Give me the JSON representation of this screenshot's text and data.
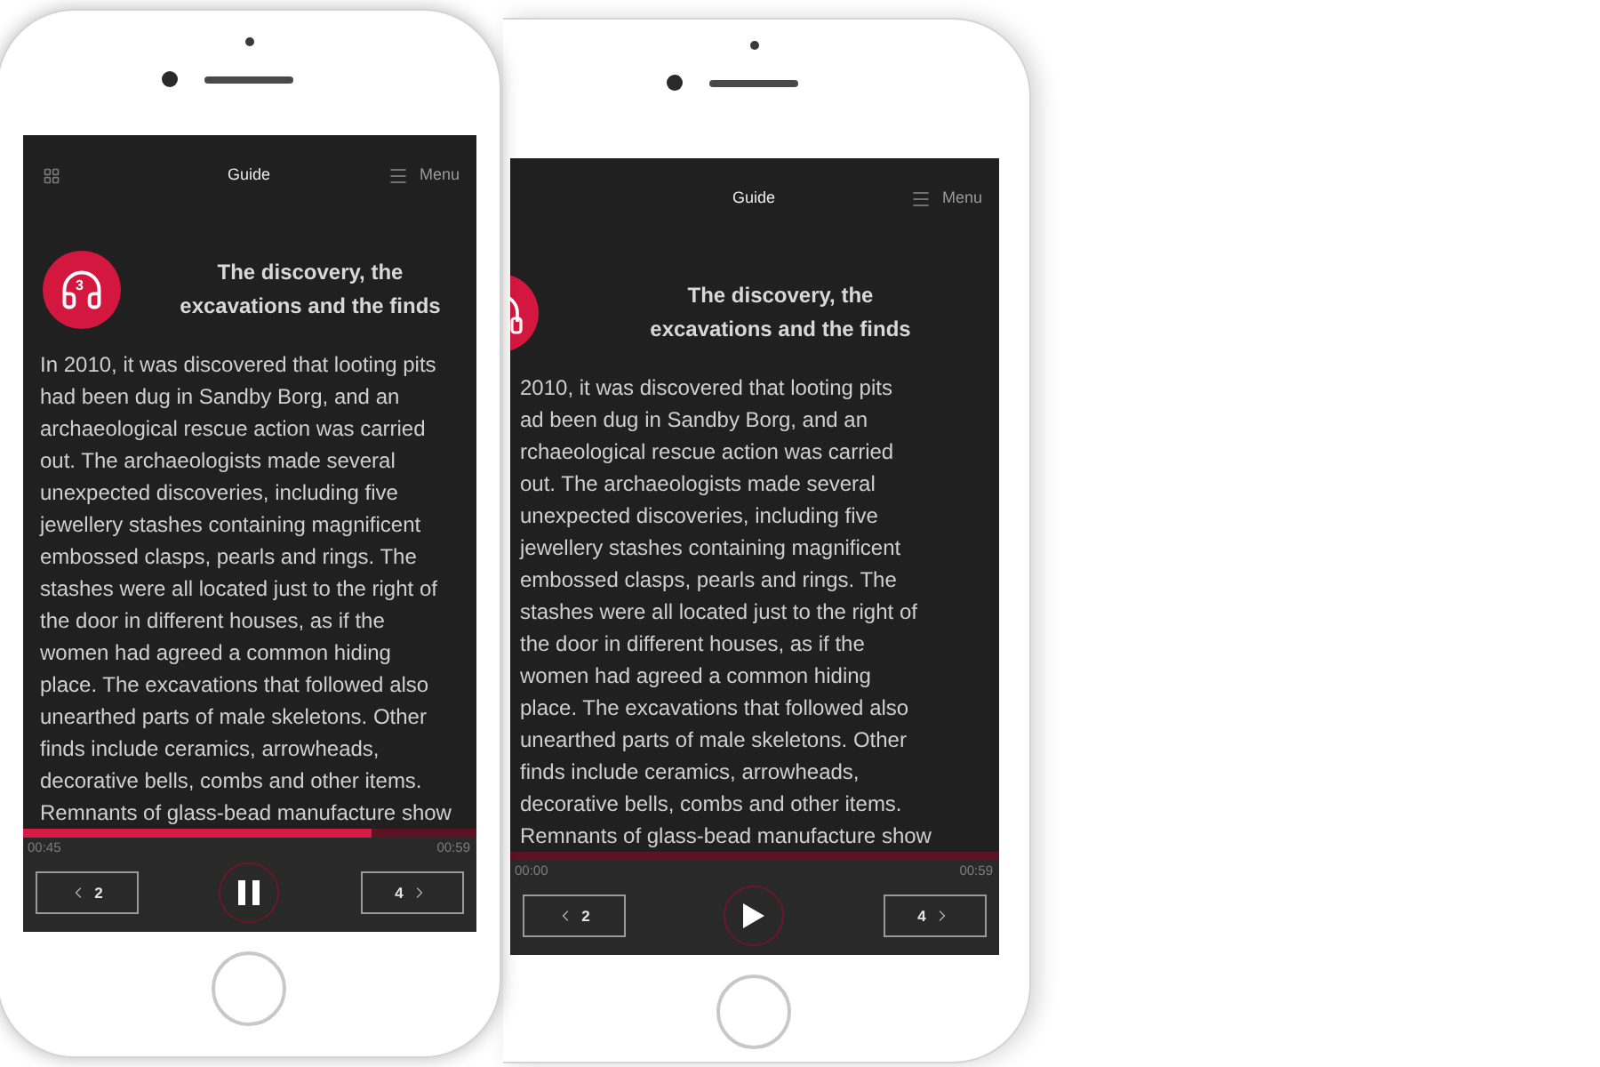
{
  "phones": [
    {
      "kind": "front",
      "header": {
        "grid_button": true,
        "title": "Guide",
        "menu_label": "Menu"
      },
      "badge": {
        "kind": "full",
        "number": "3"
      },
      "title_lines": [
        "The discovery, the",
        "excavations and the finds"
      ],
      "body_lines": [
        "In 2010, it was discovered that looting pits",
        "had been dug in Sandby Borg, and an",
        "archaeological rescue action was carried",
        "out. The archaeologists made several",
        "unexpected discoveries, including five",
        "jewellery stashes containing magnificent",
        "embossed clasps, pearls and rings. The",
        "stashes were all located just to the right of",
        "the door in different houses, as if the",
        "women had agreed a common hiding",
        "place. The excavations that followed also",
        "unearthed parts of male skeletons. Other",
        "finds include ceramics, arrowheads,",
        "decorative bells, combs and other items.",
        "Remnants of glass-bead manufacture show"
      ],
      "progress": {
        "level": 0.77,
        "elapsed": "00:45",
        "total": "00:59"
      },
      "playing": true,
      "previous_button": {
        "label": "2"
      },
      "next_button": {
        "label": "4"
      }
    },
    {
      "kind": "tilted",
      "header": {
        "title": "Guide",
        "menu_label": "Menu"
      },
      "badge": {
        "kind": "partial"
      },
      "title_lines": [
        "The discovery, the",
        "excavations and the finds"
      ],
      "body_lines": [
        "2010, it was discovered that looting pits",
        "ad been dug in Sandby Borg, and an",
        "rchaeological rescue action was carried",
        "out. The archaeologists made several",
        "unexpected discoveries, including five",
        "jewellery stashes containing magnificent",
        "embossed clasps, pearls and rings. The",
        "stashes were all located just to the right of",
        "the door in different houses, as if the",
        "women had agreed a common hiding",
        "place. The excavations that followed also",
        "unearthed parts of male skeletons. Other",
        "finds include ceramics, arrowheads,",
        "decorative bells, combs and other items.",
        "Remnants of glass-bead manufacture show"
      ],
      "progress": {
        "elapsed": "00:00",
        "total": "00:59"
      },
      "playing": false,
      "previous_button": {
        "label": "2"
      },
      "next_button": {
        "label": "4"
      }
    }
  ]
}
